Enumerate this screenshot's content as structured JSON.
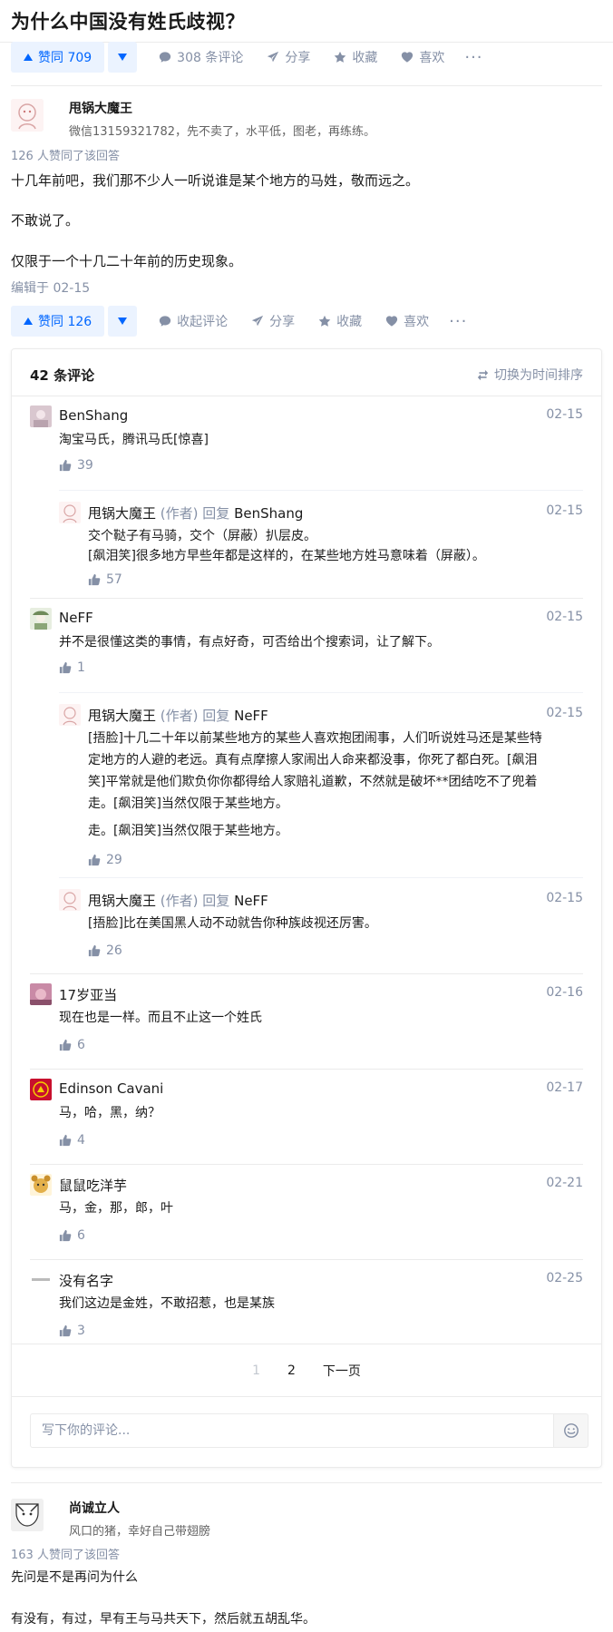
{
  "question": {
    "title": "为什么中国没有姓氏歧视？"
  },
  "top_actions": {
    "vote_label": "赞同 709",
    "comments": "308 条评论",
    "share": "分享",
    "favorite": "收藏",
    "like": "喜欢",
    "more": "···"
  },
  "answer1": {
    "author_name": "甩锅大魔王",
    "author_bio": "微信13159321782，先不卖了，水平低，图老，再练练。",
    "vote_count": "126 人赞同了该回答",
    "paragraphs": [
      "十几年前吧，我们那不少人一听说谁是某个地方的马姓，敬而远之。",
      "不敢说了。",
      "仅限于一个十几二十年前的历史现象。"
    ],
    "edited": "编辑于 02-15",
    "actions": {
      "vote_label": "赞同 126",
      "comments": "收起评论",
      "share": "分享",
      "favorite": "收藏",
      "like": "喜欢",
      "more": "···"
    }
  },
  "comments": {
    "count": "42 条评论",
    "sort": "切换为时间排序",
    "author_tag": "(作者)",
    "reply_word": "回复",
    "items": [
      {
        "name": "BenShang",
        "date": "02-15",
        "body": [
          "淘宝马氏，腾讯马氏[惊喜]"
        ],
        "likes": "39"
      },
      {
        "name": "甩锅大魔王",
        "reply_to": "BenShang",
        "date": "02-15",
        "body": [
          "交个鞑子有马骑，交个（屏蔽）扒层皮。",
          "[飙泪笑]很多地方早些年都是这样的，在某些地方姓马意味着（屏蔽）。"
        ],
        "likes": "57"
      },
      {
        "name": "NeFF",
        "date": "02-15",
        "body": [
          "并不是很懂这类的事情，有点好奇，可否给出个搜索词，让了解下。"
        ],
        "likes": "1"
      },
      {
        "name": "甩锅大魔王",
        "reply_to": "NeFF",
        "date": "02-15",
        "body": [
          "[捂脸]十几二十年以前某些地方的某些人喜欢抱团闹事，人们听说姓马还是某些特",
          "定地方的人避的老远。真有点摩擦人家闹出人命来都没事，你死了都白死。[飙泪",
          "笑]平常就是他们欺负你你都得给人家赔礼道歉，不然就是破坏**团结吃不了兜着",
          "走。[飙泪笑]当然仅限于某些地方。"
        ],
        "extra": "走。[飙泪笑]当然仅限于某些地方。",
        "likes": "29"
      },
      {
        "name": "甩锅大魔王",
        "reply_to": "NeFF",
        "date": "02-15",
        "body": [
          "[捂脸]比在美国黑人动不动就告你种族歧视还厉害。"
        ],
        "likes": "26"
      },
      {
        "name": "17岁亚当",
        "date": "02-16",
        "body": [
          "现在也是一样。而且不止这一个姓氏"
        ],
        "likes": "6"
      },
      {
        "name": "Edinson Cavani",
        "date": "02-17",
        "body": [
          "马，哈，黑，纳？"
        ],
        "likes": "4"
      },
      {
        "name": "鼠鼠吃洋芋",
        "date": "02-21",
        "body": [
          "马，金，那，郎，叶"
        ],
        "likes": "6"
      },
      {
        "name": "没有名字",
        "date": "02-25",
        "body": [
          "我们这边是金姓，不敢招惹，也是某族"
        ],
        "likes": "3"
      }
    ],
    "pager": {
      "current": "1",
      "page2": "2",
      "next": "下一页"
    },
    "input_placeholder": "写下你的评论..."
  },
  "answer2": {
    "author_name": "尚诚立人",
    "author_bio": "风口的猪，幸好自己带翅膀",
    "vote_count": "163 人赞同了该回答",
    "paragraphs": [
      "先问是不是再问为什么",
      "有没有，有过，早有王与马共天下，然后就五胡乱华。"
    ]
  },
  "icons": {
    "comment": "comment-icon",
    "share": "paper-plane-icon",
    "favorite": "star-icon",
    "like": "heart-icon",
    "sort": "swap-arrows-icon",
    "thumb": "thumbs-up-icon",
    "emoji": "smiley-icon"
  },
  "colors": {
    "accent": "#0066ff",
    "accent_bg": "#ebf3ff",
    "muted": "#8590a6",
    "text": "#1a1a1a"
  }
}
